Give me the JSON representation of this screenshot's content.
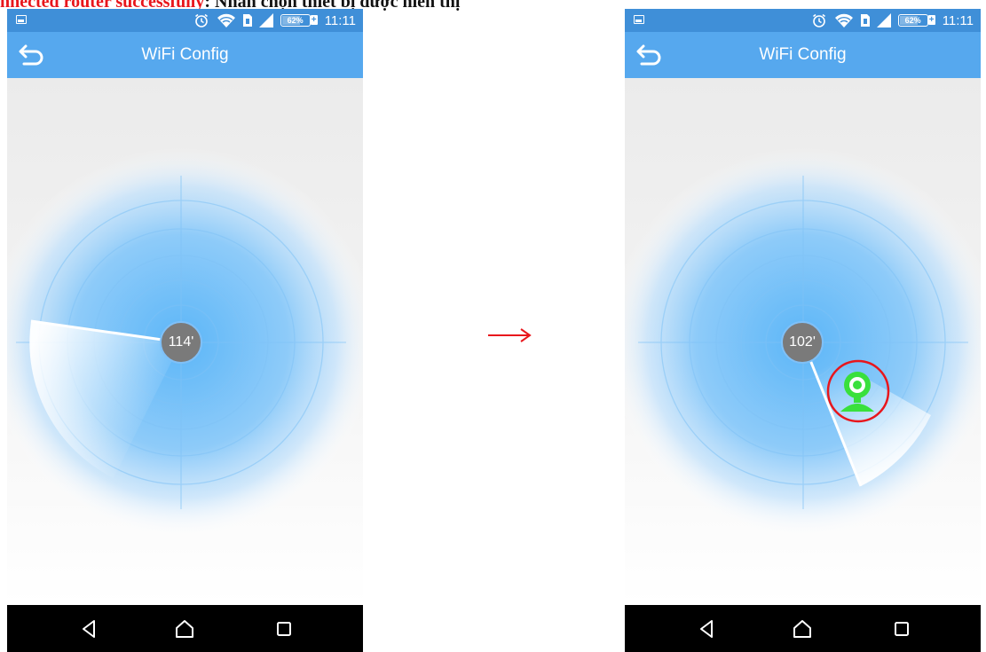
{
  "caption": {
    "red_text": "nnected router successfully",
    "black_text": ": Nhấn chọn thiết bị được hiển thị"
  },
  "screens": [
    {
      "status_bar": {
        "time": "11:11",
        "battery": "62%"
      },
      "header": {
        "title": "WiFi Config"
      },
      "radar": {
        "angle_label": "114'",
        "device_found": false
      }
    },
    {
      "status_bar": {
        "time": "11:11",
        "battery": "62%"
      },
      "header": {
        "title": "WiFi Config"
      },
      "radar": {
        "angle_label": "102'",
        "device_found": true
      }
    }
  ],
  "transition_arrow": "→",
  "icons": {
    "back": "back-arrow-icon",
    "nav": [
      "nav-back-icon",
      "nav-home-icon",
      "nav-recents-icon"
    ],
    "device": "camera-device-icon"
  },
  "colors": {
    "status_bar": "#3f8fd8",
    "title_bar": "#56a8ee",
    "radar_blue": "#5cb6f8",
    "device_green": "#39e03c",
    "highlight_red": "#e8161c",
    "arrow_red": "#e8161c"
  }
}
